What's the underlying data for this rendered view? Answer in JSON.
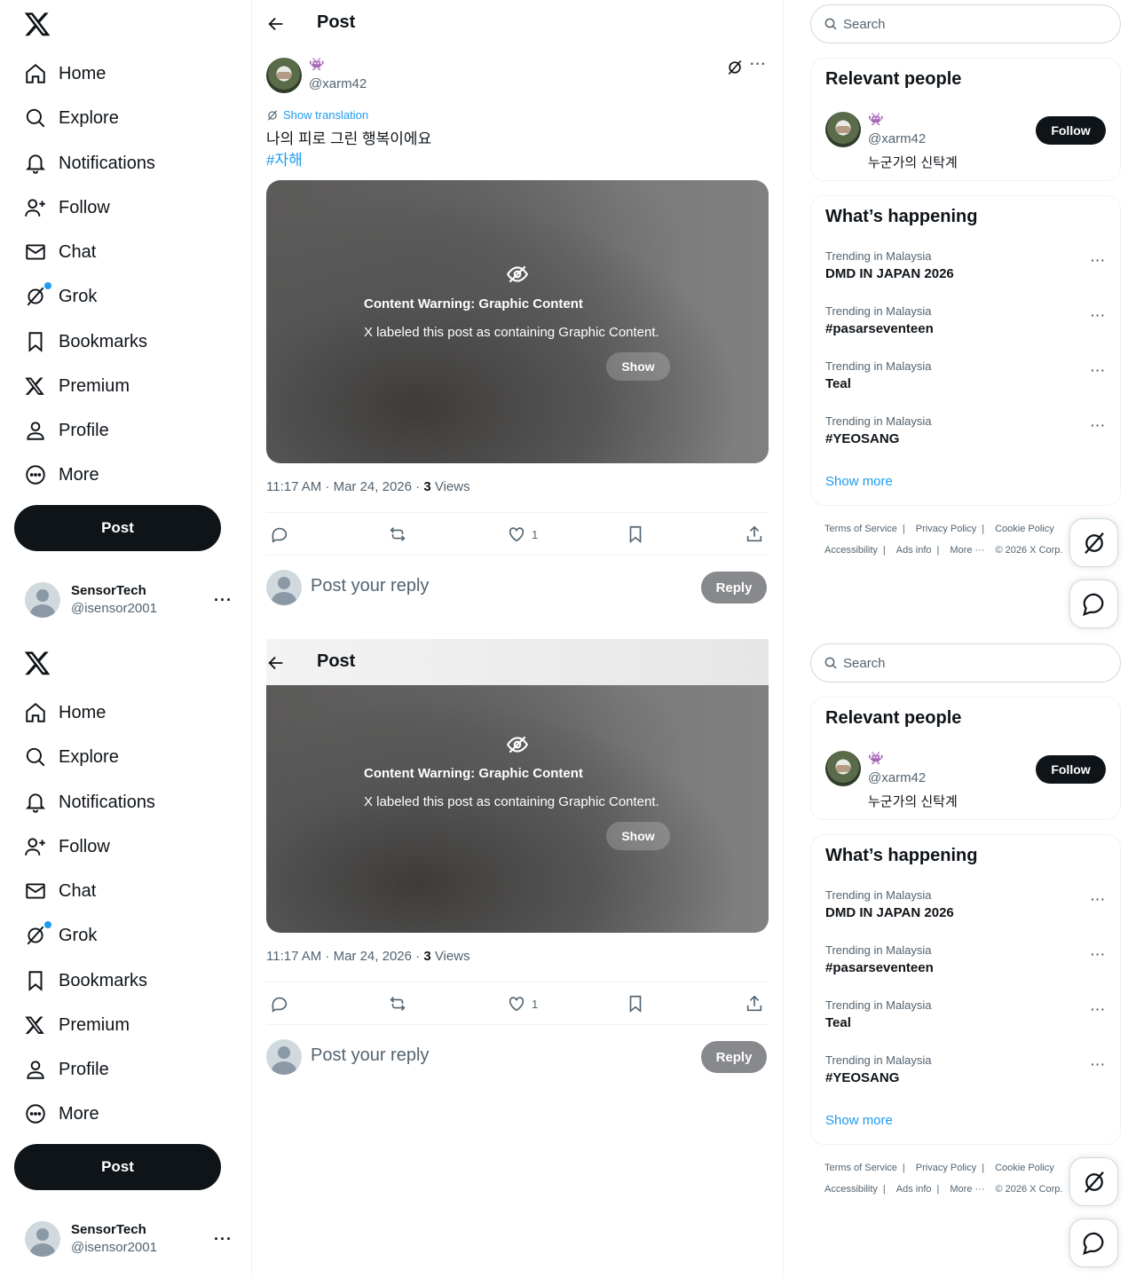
{
  "nav": {
    "items": [
      {
        "label": "Home",
        "icon": "home-icon"
      },
      {
        "label": "Explore",
        "icon": "search-icon"
      },
      {
        "label": "Notifications",
        "icon": "bell-icon"
      },
      {
        "label": "Follow",
        "icon": "person-add-icon"
      },
      {
        "label": "Chat",
        "icon": "mail-icon"
      },
      {
        "label": "Grok",
        "icon": "grok-icon"
      },
      {
        "label": "Bookmarks",
        "icon": "bookmark-icon"
      },
      {
        "label": "Premium",
        "icon": "x-logo-icon"
      },
      {
        "label": "Profile",
        "icon": "person-icon"
      },
      {
        "label": "More",
        "icon": "more-circle-icon"
      }
    ],
    "post_button": "Post"
  },
  "account": {
    "name": "SensorTech",
    "handle": "@isensor2001",
    "more": "···"
  },
  "header": {
    "title": "Post"
  },
  "post": {
    "author_emoji": "👾",
    "author_handle": "@xarm42",
    "more": "···",
    "show_translation": "Show translation",
    "text": "나의 피로 그린 행복이에요",
    "hashtag": "#자해",
    "warning_title": "Content Warning: Graphic Content",
    "warning_desc": "X labeled this post as containing Graphic Content.",
    "show_label": "Show",
    "time": "11:17 AM · Mar 24, 2026 · ",
    "views_count": "3",
    "views_label": " Views",
    "like_count": "1",
    "reply_placeholder": "Post your reply",
    "reply_button": "Reply"
  },
  "search": {
    "placeholder": "Search"
  },
  "relevant": {
    "title": "Relevant people",
    "emoji": "👾",
    "handle": "@xarm42",
    "bio": "누군가의 신탁계",
    "follow": "Follow"
  },
  "trends": {
    "title": "What’s happening",
    "items": [
      {
        "context": "Trending in Malaysia",
        "name": "DMD IN JAPAN 2026"
      },
      {
        "context": "Trending in Malaysia",
        "name": "#pasarseventeen"
      },
      {
        "context": "Trending in Malaysia",
        "name": "Teal"
      },
      {
        "context": "Trending in Malaysia",
        "name": "#YEOSANG"
      }
    ],
    "show_more": "Show more",
    "more": "···"
  },
  "footer": {
    "terms": "Terms of Service",
    "privacy": "Privacy Policy",
    "cookie": "Cookie Policy",
    "accessibility": "Accessibility",
    "ads": "Ads info",
    "more": "More ···",
    "copyright": "© 2026 X Corp."
  },
  "colors": {
    "accent": "#1d9bf0",
    "text": "#0f1419",
    "muted": "#536471"
  }
}
